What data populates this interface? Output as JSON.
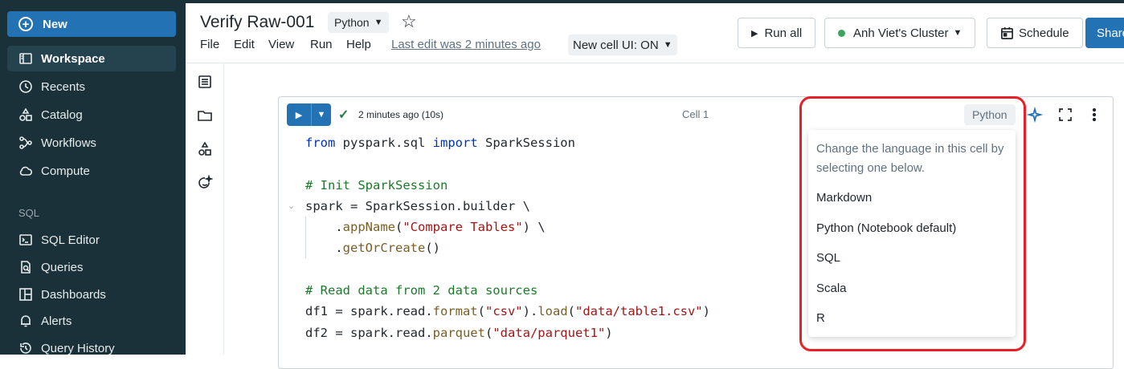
{
  "sidebar": {
    "new_label": "New",
    "items": [
      {
        "label": "Workspace"
      },
      {
        "label": "Recents"
      },
      {
        "label": "Catalog"
      },
      {
        "label": "Workflows"
      },
      {
        "label": "Compute"
      }
    ],
    "sql_section_label": "SQL",
    "sql_items": [
      {
        "label": "SQL Editor"
      },
      {
        "label": "Queries"
      },
      {
        "label": "Dashboards"
      },
      {
        "label": "Alerts"
      },
      {
        "label": "Query History"
      }
    ]
  },
  "header": {
    "title": "Verify Raw-001",
    "language": "Python",
    "menu": [
      "File",
      "Edit",
      "View",
      "Run",
      "Help"
    ],
    "last_edit": "Last edit was 2 minutes ago",
    "new_cell_ui": "New cell UI: ON",
    "run_all_label": "Run all",
    "cluster_label": "Anh Viet's Cluster",
    "cluster_status_color": "#3ba55d",
    "schedule_label": "Schedule",
    "share_label": "Share"
  },
  "cell": {
    "exec_time": "2 minutes ago (10s)",
    "label": "Cell 1",
    "language_button": "Python",
    "code_lines": [
      "from pyspark.sql import SparkSession",
      "",
      "# Init SparkSession",
      "spark = SparkSession.builder \\",
      "    .appName(\"Compare Tables\") \\",
      "    .getOrCreate()",
      "",
      "# Read data from 2 data sources",
      "df1 = spark.read.format(\"csv\").load(\"data/table1.csv\")",
      "df2 = spark.read.parquet(\"data/parquet1\")"
    ]
  },
  "language_dropdown": {
    "description": "Change the language in this cell by selecting one below.",
    "options": [
      "Markdown",
      "Python (Notebook default)",
      "SQL",
      "Scala",
      "R"
    ]
  }
}
